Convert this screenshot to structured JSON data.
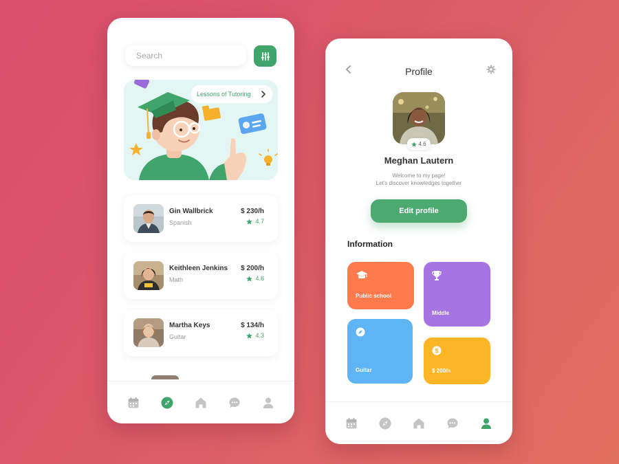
{
  "left_screen": {
    "search": {
      "placeholder": "Search"
    },
    "filter_icon": "sliders-icon",
    "banner": {
      "label": "Lessons of Tutoring"
    },
    "tutors": [
      {
        "name": "Gin Wallbrick",
        "subject": "Spanish",
        "price": "$ 230/h",
        "rating": "4.7"
      },
      {
        "name": "Keithleen Jenkins",
        "subject": "Math",
        "price": "$ 200/h",
        "rating": "4.6"
      },
      {
        "name": "Martha Keys",
        "subject": "Guitar",
        "price": "$ 134/h",
        "rating": "4.3"
      }
    ],
    "nav": [
      "calendar-icon",
      "compass-icon",
      "home-icon",
      "chat-icon",
      "user-icon"
    ],
    "nav_active": "compass-icon"
  },
  "right_screen": {
    "title": "Profile",
    "avatar_rating": "4.6",
    "name": "Meghan Lautern",
    "bio_line1": "Welcome to my page!",
    "bio_line2": "Let's discover knowledges together",
    "edit_label": "Edit profile",
    "section_title": "Information",
    "tiles": [
      {
        "label": "Public school",
        "icon": "graduation-cap-icon",
        "color": "#ff7a4d"
      },
      {
        "label": "Middle",
        "icon": "trophy-icon",
        "color": "#a673e2"
      },
      {
        "label": "Guitar",
        "icon": "compass-icon",
        "color": "#5eb4f5"
      },
      {
        "label": "$ 200/h",
        "icon": "dollar-coin-icon",
        "color": "#fdb528"
      }
    ],
    "nav": [
      "calendar-icon",
      "compass-icon",
      "home-icon",
      "chat-icon",
      "user-icon"
    ],
    "nav_active": "user-icon"
  },
  "colors": {
    "accent_green": "#3fa56a",
    "inactive_icon": "#c4c4c4"
  }
}
